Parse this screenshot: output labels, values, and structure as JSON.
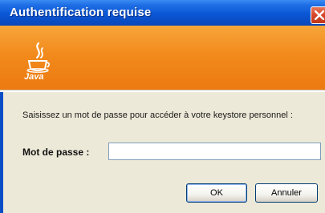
{
  "window": {
    "title": "Authentification requise"
  },
  "banner": {
    "logo_text": "Java"
  },
  "content": {
    "message": "Saisissez un mot de passe pour accéder à votre keystore personnel :",
    "password_label": "Mot de passe :",
    "password_value": ""
  },
  "buttons": {
    "ok_label": "OK",
    "cancel_label": "Annuler"
  },
  "icons": {
    "close": "close-icon",
    "logo": "java-logo-icon"
  },
  "colors": {
    "titlebar": "#0a57d6",
    "banner": "#f28a1c",
    "dialog_bg": "#ece9d8",
    "close_button": "#d6452a"
  }
}
